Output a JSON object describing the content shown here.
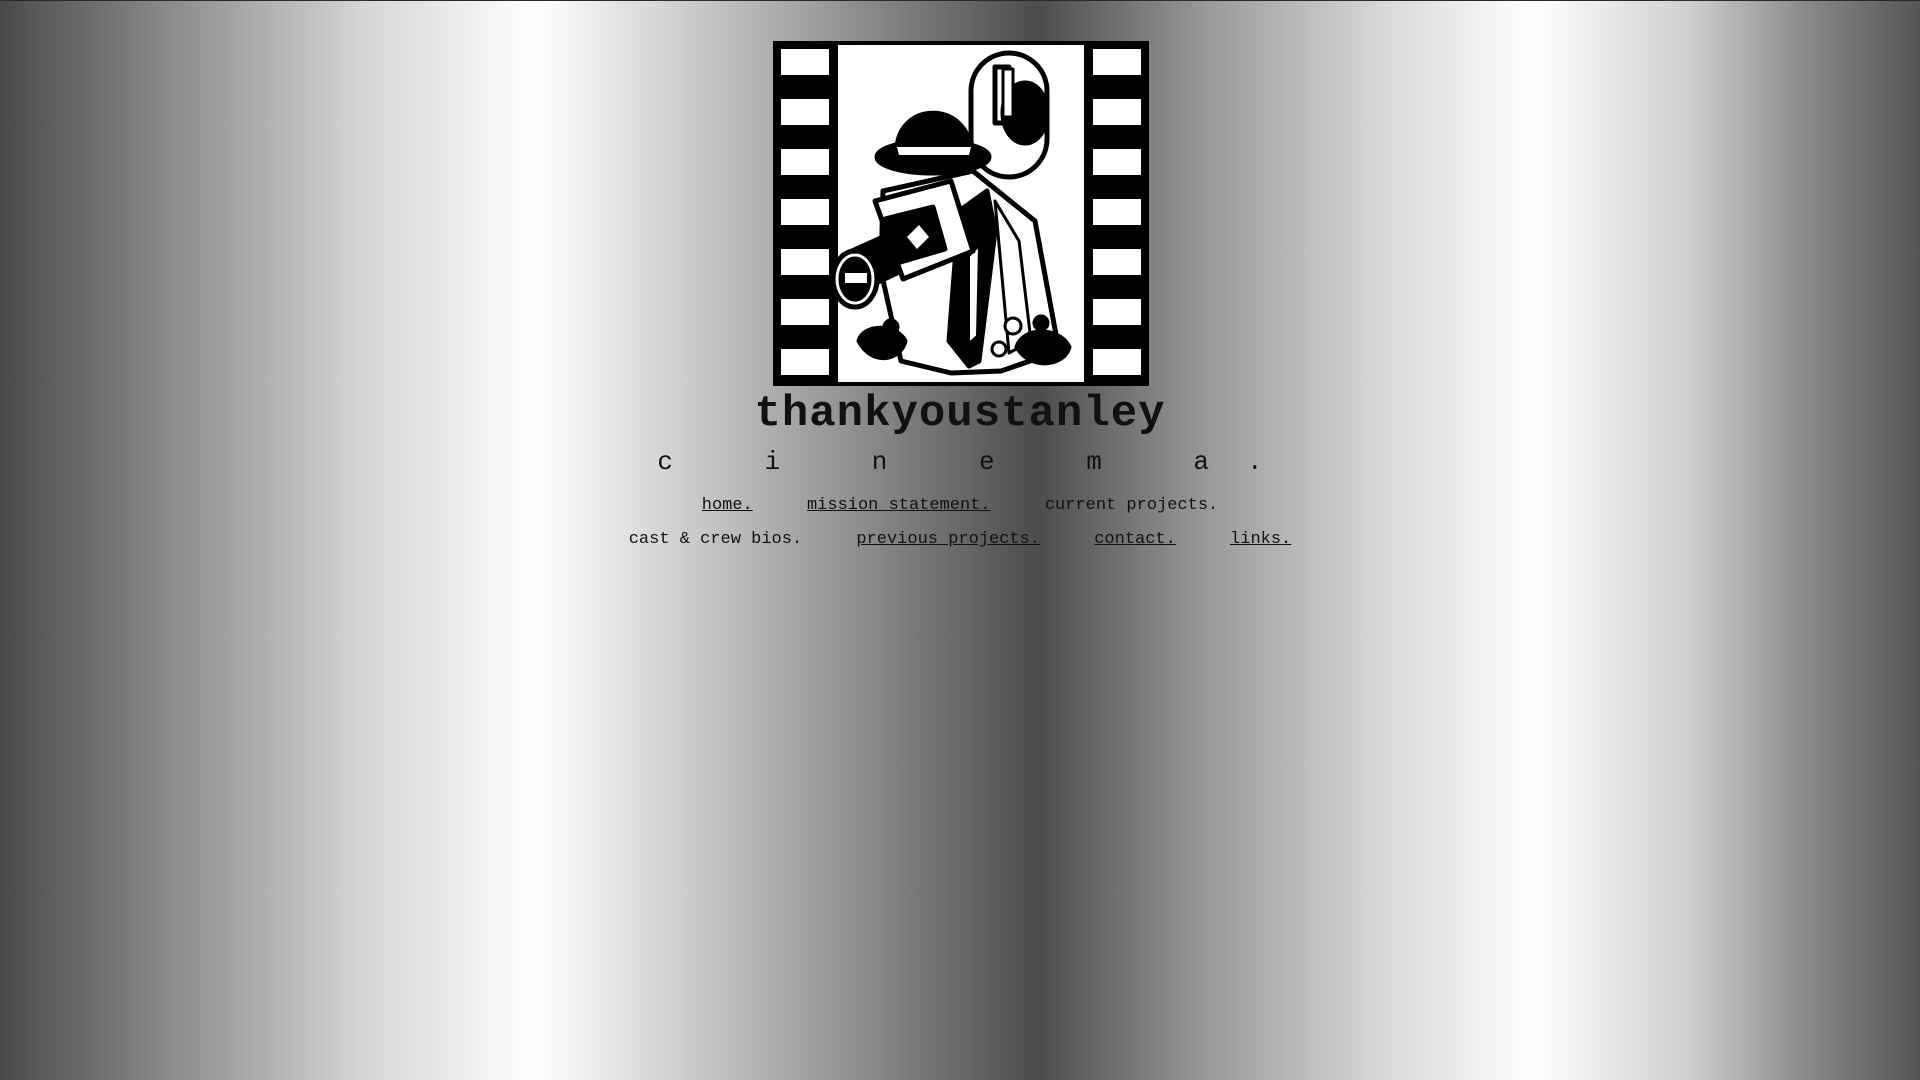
{
  "site": {
    "title": "thankyoustanley",
    "subtitle": "c i n e m a.",
    "logo_icon": "film-strip-cameraman-icon"
  },
  "nav": {
    "row1": [
      {
        "label": "home.",
        "is_link": true
      },
      {
        "label": "mission statement.",
        "is_link": true
      },
      {
        "label": "current projects.",
        "is_link": false
      }
    ],
    "row2": [
      {
        "label": "cast & crew bios.",
        "is_link": false
      },
      {
        "label": "previous projects.",
        "is_link": true
      },
      {
        "label": "contact.",
        "is_link": true
      },
      {
        "label": "links.",
        "is_link": true
      }
    ]
  },
  "colors": {
    "text": "#111111",
    "background_dark": "#4a4a4a",
    "background_light": "#ffffff"
  }
}
